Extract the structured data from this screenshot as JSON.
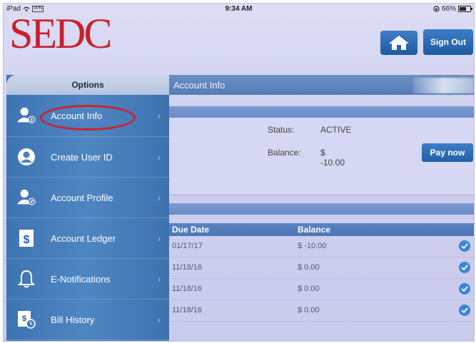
{
  "status_bar": {
    "device": "iPad",
    "vpn": "VPN",
    "time": "9:34 AM",
    "battery": "66%"
  },
  "header": {
    "logo": "SEDC",
    "sign_out_label": "Sign Out"
  },
  "sidebar": {
    "title": "Options",
    "items": [
      {
        "label": "Account Info",
        "icon": "user-info-icon"
      },
      {
        "label": "Create User ID",
        "icon": "user-id-icon"
      },
      {
        "label": "Account Profile",
        "icon": "user-profile-icon"
      },
      {
        "label": "Account Ledger",
        "icon": "ledger-dollar-icon"
      },
      {
        "label": "E-Notifications",
        "icon": "bell-icon"
      },
      {
        "label": "Bill History",
        "icon": "bill-history-icon"
      }
    ]
  },
  "main": {
    "title": "Account Info",
    "status_label": "Status:",
    "status_value": "ACTIVE",
    "balance_label": "Balance:",
    "balance_value": "$ -10.00",
    "pay_now_label": "Pay now",
    "table": {
      "columns": [
        "Due Date",
        "Balance"
      ],
      "rows": [
        {
          "due_date": "01/17/17",
          "balance": "$ -10.00"
        },
        {
          "due_date": "11/18/16",
          "balance": "$ 0.00"
        },
        {
          "due_date": "11/18/16",
          "balance": "$ 0.00"
        },
        {
          "due_date": "11/18/16",
          "balance": "$ 0.00"
        }
      ]
    }
  },
  "colors": {
    "brand_red": "#c8202b",
    "accent_blue": "#2b6cb4",
    "sidebar_blue": "#4a7fbd"
  }
}
